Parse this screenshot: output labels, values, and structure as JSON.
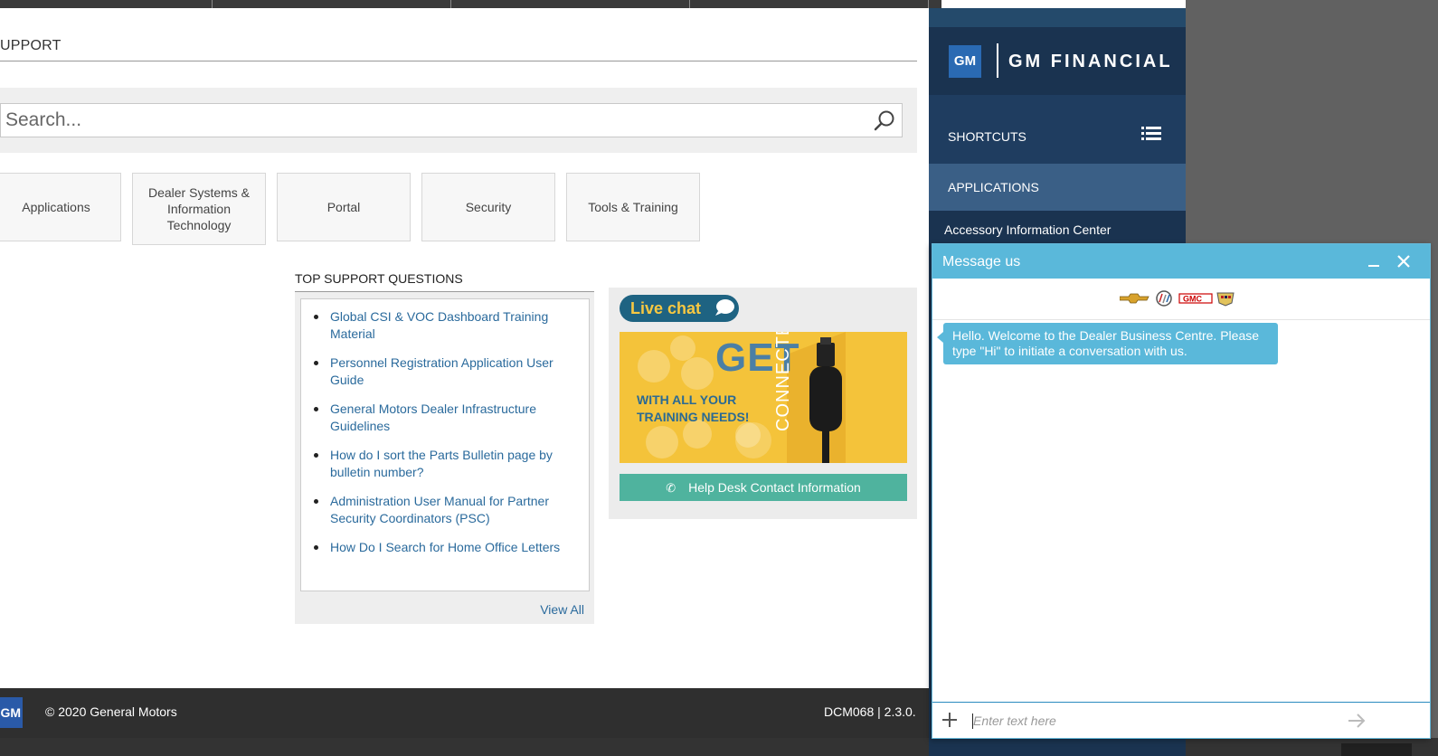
{
  "support": {
    "title": "UPPORT",
    "search_placeholder": "Search..."
  },
  "categories": [
    {
      "label": "Applications"
    },
    {
      "label": "Dealer Systems & Information Technology"
    },
    {
      "label": "Portal"
    },
    {
      "label": "Security"
    },
    {
      "label": "Tools & Training"
    }
  ],
  "top_questions": {
    "title": "TOP SUPPORT QUESTIONS",
    "items": [
      "Global CSI & VOC Dashboard Training Material",
      "Personnel Registration Application User Guide",
      "General Motors Dealer Infrastructure Guidelines",
      "How do I sort the Parts Bulletin page by bulletin number?",
      "Administration User Manual for Partner Security Coordinators (PSC)",
      "How Do I Search for Home Office Letters"
    ],
    "view_all": "View All"
  },
  "promo": {
    "live_chat": "Live chat",
    "banner_get": "GET",
    "banner_connected": "CONNECTED",
    "banner_sub_1": "WITH ALL YOUR",
    "banner_sub_2": "TRAINING NEEDS!",
    "helpdesk": "Help Desk Contact Information"
  },
  "footer": {
    "logo": "GM",
    "copyright": "© 2020 General Motors",
    "version": "DCM068   |   2.3.0."
  },
  "sidebar": {
    "logo": "GM",
    "brand": "GM FINANCIAL",
    "shortcuts": "SHORTCUTS",
    "applications": "APPLICATIONS",
    "first_item": "Accessory Information Center"
  },
  "chat": {
    "title": "Message us",
    "welcome": "Hello. Welcome to the Dealer Business Centre. Please type \"Hi\" to initiate a conversation with us.",
    "input_placeholder": "Enter text here",
    "brands": [
      "chevrolet-logo",
      "buick-logo",
      "gmc-logo",
      "cadillac-logo"
    ]
  },
  "colors": {
    "sidebar_bg": "#1a3350",
    "chat_header": "#5ab8da",
    "helpdesk": "#4fb39e",
    "banner": "#f4c33a",
    "link": "#2a6a9c"
  }
}
